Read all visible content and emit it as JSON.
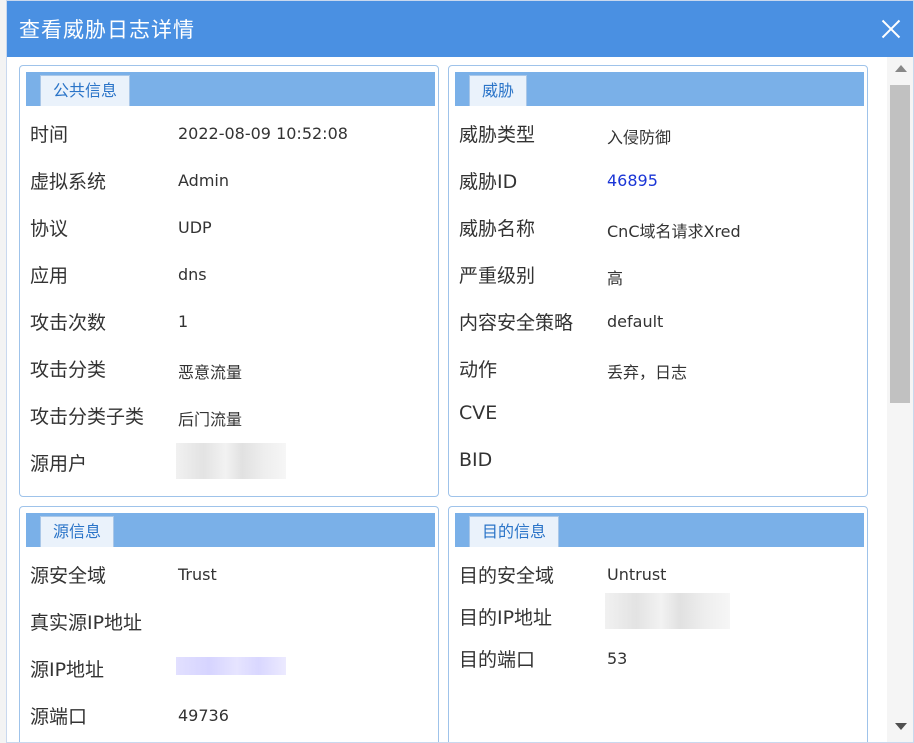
{
  "dialog": {
    "title": "查看威胁日志详情"
  },
  "public_info": {
    "heading": "公共信息",
    "rows": [
      {
        "label": "时间",
        "value": "2022-08-09 10:52:08"
      },
      {
        "label": "虚拟系统",
        "value": "Admin"
      },
      {
        "label": "协议",
        "value": "UDP"
      },
      {
        "label": "应用",
        "value": "dns"
      },
      {
        "label": "攻击次数",
        "value": "1"
      },
      {
        "label": "攻击分类",
        "value": "恶意流量"
      },
      {
        "label": "攻击分类子类",
        "value": "后门流量"
      },
      {
        "label": "源用户",
        "value": ""
      }
    ]
  },
  "threat": {
    "heading": "威胁",
    "rows": [
      {
        "label": "威胁类型",
        "value": "入侵防御"
      },
      {
        "label": "威胁ID",
        "value": "46895"
      },
      {
        "label": "威胁名称",
        "value": "CnC域名请求Xred"
      },
      {
        "label": "严重级别",
        "value": "高"
      },
      {
        "label": "内容安全策略",
        "value": "default"
      },
      {
        "label": "动作",
        "value": "丢弃，日志"
      },
      {
        "label": "CVE",
        "value": ""
      },
      {
        "label": "BID",
        "value": ""
      }
    ]
  },
  "source_info": {
    "heading": "源信息",
    "rows": [
      {
        "label": "源安全域",
        "value": "Trust"
      },
      {
        "label": "真实源IP地址",
        "value": ""
      },
      {
        "label": "源IP地址",
        "value": ""
      },
      {
        "label": "源端口",
        "value": "49736"
      }
    ]
  },
  "dest_info": {
    "heading": "目的信息",
    "rows": [
      {
        "label": "目的安全域",
        "value": "Untrust"
      },
      {
        "label": "目的IP地址",
        "value": ""
      },
      {
        "label": "目的端口",
        "value": "53"
      }
    ]
  },
  "colors": {
    "titlebar": "#4a90e2",
    "section_header": "#7ab0e8",
    "link": "#1a35d6",
    "panel_border": "#9fc3ea"
  }
}
